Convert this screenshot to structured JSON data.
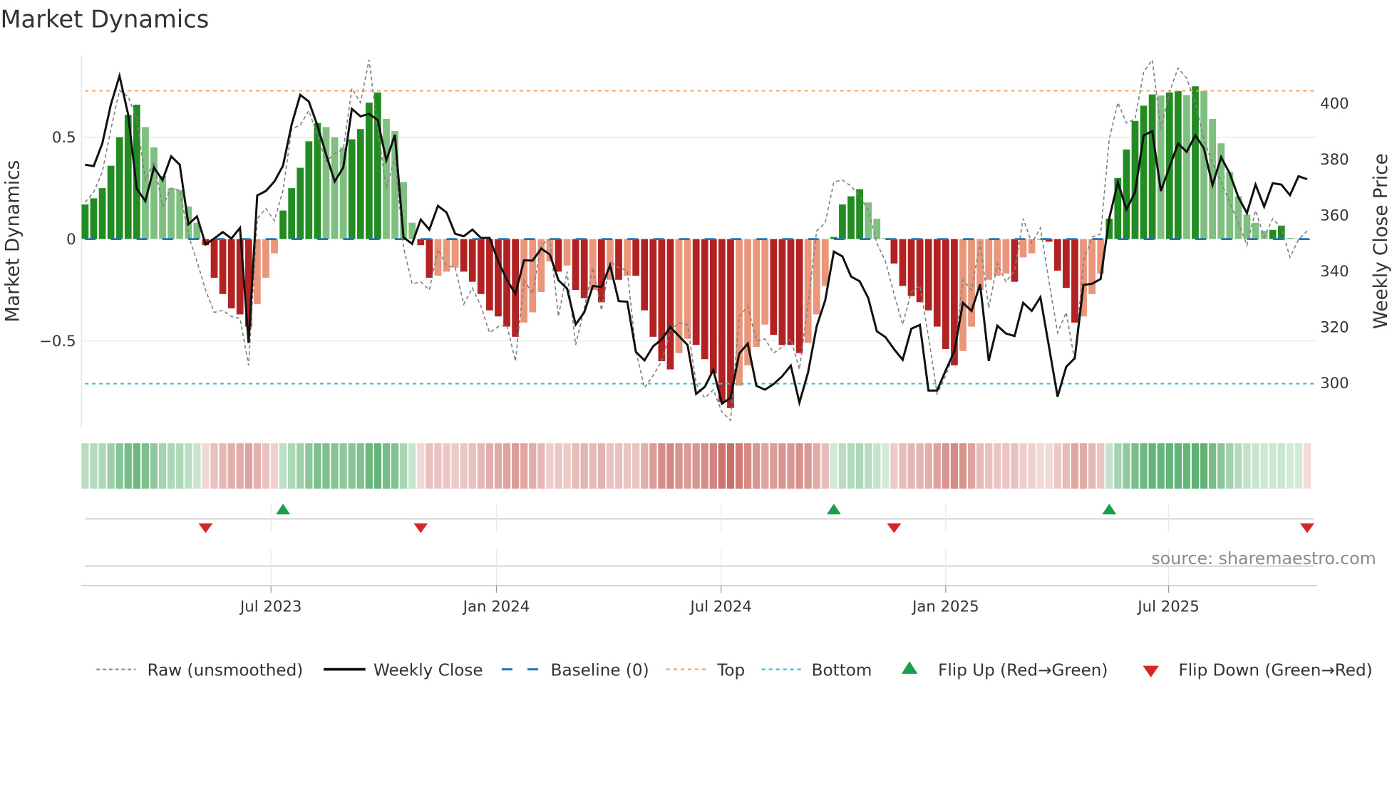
{
  "title": "Market Dynamics",
  "source": "source: sharemaestro.com",
  "colors": {
    "bar_up_strong": "#228b22",
    "bar_up_weak": "#7fbf7f",
    "bar_down_strong": "#b22222",
    "bar_down_weak": "#e9967a",
    "raw": "#808080",
    "close": "#111111",
    "baseline": "#1f77b4",
    "top": "#f4a460",
    "bottom": "#26c6da",
    "flip_up": "#1a9e4a",
    "flip_down": "#d62728"
  },
  "chart_data": {
    "type": "bar",
    "title": "Market Dynamics",
    "ylabel": "Market Dynamics",
    "y2label": "Weekly Close Price",
    "ylim": [
      -0.92,
      0.9
    ],
    "y2lim": [
      284,
      417
    ],
    "yticks": [
      {
        "v": 0.5,
        "label": "0.5"
      },
      {
        "v": 0,
        "label": "0"
      },
      {
        "v": -0.5,
        "label": "−0.5"
      }
    ],
    "y2ticks": [
      {
        "v": 300,
        "label": "300"
      },
      {
        "v": 320,
        "label": "320"
      },
      {
        "v": 340,
        "label": "340"
      },
      {
        "v": 360,
        "label": "360"
      },
      {
        "v": 380,
        "label": "380"
      },
      {
        "v": 400,
        "label": "400"
      }
    ],
    "xticks": [
      {
        "week": 21.6,
        "label": "Jul 2023"
      },
      {
        "week": 47.8,
        "label": "Jan 2024"
      },
      {
        "week": 73.9,
        "label": "Jul 2024"
      },
      {
        "week": 100.0,
        "label": "Jan 2025"
      },
      {
        "week": 125.9,
        "label": "Jul 2025"
      }
    ],
    "thresholds": {
      "baseline": 0,
      "top": 0.728,
      "bottom": -0.71
    },
    "dynamics": [
      0.17,
      0.2,
      0.25,
      0.36,
      0.5,
      0.61,
      0.66,
      0.55,
      0.45,
      0.31,
      0.25,
      0.24,
      0.16,
      0.08,
      -0.03,
      -0.19,
      -0.27,
      -0.34,
      -0.37,
      -0.43,
      -0.32,
      -0.19,
      -0.07,
      0.14,
      0.25,
      0.35,
      0.48,
      0.57,
      0.55,
      0.5,
      0.45,
      0.49,
      0.54,
      0.67,
      0.72,
      0.59,
      0.53,
      0.28,
      0.08,
      -0.03,
      -0.19,
      -0.18,
      -0.16,
      -0.14,
      -0.16,
      -0.21,
      -0.27,
      -0.35,
      -0.38,
      -0.43,
      -0.48,
      -0.41,
      -0.36,
      -0.26,
      -0.11,
      -0.16,
      -0.13,
      -0.25,
      -0.29,
      -0.25,
      -0.31,
      -0.2,
      -0.2,
      -0.18,
      -0.18,
      -0.35,
      -0.48,
      -0.6,
      -0.64,
      -0.56,
      -0.49,
      -0.52,
      -0.59,
      -0.66,
      -0.8,
      -0.83,
      -0.72,
      -0.62,
      -0.53,
      -0.42,
      -0.47,
      -0.52,
      -0.52,
      -0.56,
      -0.51,
      -0.37,
      -0.23,
      0.01,
      0.17,
      0.21,
      0.245,
      0.18,
      0.1,
      0.005,
      -0.12,
      -0.23,
      -0.28,
      -0.31,
      -0.35,
      -0.43,
      -0.54,
      -0.62,
      -0.55,
      -0.43,
      -0.25,
      -0.2,
      -0.18,
      -0.17,
      -0.21,
      -0.09,
      -0.07,
      -0.005,
      -0.013,
      -0.155,
      -0.24,
      -0.41,
      -0.38,
      -0.27,
      -0.17,
      0.1,
      0.3,
      0.44,
      0.58,
      0.655,
      0.71,
      0.705,
      0.72,
      0.727,
      0.707,
      0.75,
      0.727,
      0.59,
      0.47,
      0.33,
      0.21,
      0.12,
      0.08,
      0.04,
      0.045,
      0.066,
      0.006,
      0.002,
      -0.002
    ],
    "raw": [
      0.18,
      0.23,
      0.33,
      0.54,
      0.73,
      0.7,
      0.59,
      0.29,
      0.38,
      0.16,
      0.25,
      0.24,
      0.02,
      -0.11,
      -0.25,
      -0.36,
      -0.35,
      -0.38,
      -0.39,
      -0.62,
      0.1,
      0.15,
      0.09,
      0.24,
      0.54,
      0.56,
      0.63,
      0.51,
      0.38,
      0.42,
      0.44,
      0.74,
      0.67,
      0.88,
      0.54,
      0.25,
      0.4,
      -0.04,
      -0.22,
      -0.21,
      -0.25,
      -0.05,
      -0.13,
      -0.14,
      -0.32,
      -0.24,
      -0.33,
      -0.46,
      -0.43,
      -0.42,
      -0.6,
      -0.2,
      -0.27,
      -0.03,
      0.0,
      -0.38,
      -0.16,
      -0.52,
      -0.34,
      -0.14,
      -0.35,
      -0.11,
      -0.14,
      -0.155,
      -0.55,
      -0.73,
      -0.67,
      -0.6,
      -0.45,
      -0.41,
      -0.42,
      -0.71,
      -0.78,
      -0.74,
      -0.85,
      -0.89,
      -0.38,
      -0.33,
      -0.5,
      -0.49,
      -0.56,
      -0.53,
      -0.49,
      -0.64,
      -0.32,
      0.04,
      0.08,
      0.28,
      0.29,
      0.26,
      0.21,
      0.14,
      -0.02,
      -0.11,
      -0.27,
      -0.42,
      -0.26,
      -0.23,
      -0.48,
      -0.76,
      -0.67,
      -0.56,
      -0.2,
      -0.25,
      -0.015,
      -0.34,
      -0.12,
      -0.21,
      -0.155,
      0.1,
      -0.02,
      0.055,
      -0.21,
      -0.46,
      -0.36,
      -0.6,
      -0.11,
      0.01,
      0.025,
      0.49,
      0.67,
      0.57,
      0.59,
      0.82,
      0.88,
      0.54,
      0.72,
      0.84,
      0.79,
      0.67,
      0.49,
      0.37,
      0.28,
      0.18,
      0.08,
      -0.03,
      0.14,
      0.01,
      0.1,
      0.055,
      -0.09,
      -0.003,
      0.04
    ],
    "weekly_close": [
      378,
      377.5,
      385.6,
      399.6,
      409.8,
      396,
      369.4,
      365,
      377,
      372.5,
      381,
      378,
      356.7,
      359.5,
      349.5,
      351.6,
      353.9,
      351.6,
      355.4,
      314.2,
      367,
      368.6,
      372,
      377.7,
      392.4,
      403,
      400.6,
      392,
      381.7,
      372,
      377,
      398,
      395.3,
      396.2,
      394,
      379.6,
      388.7,
      352,
      349.7,
      358.4,
      354.8,
      363.3,
      360.9,
      353.3,
      352.4,
      354.8,
      351.8,
      351.8,
      343.5,
      336.9,
      331.8,
      343.8,
      343.7,
      348,
      345.9,
      336.7,
      333.7,
      320.8,
      325.2,
      334.6,
      334.3,
      342,
      329.2,
      329,
      311,
      308,
      313,
      315.5,
      319.9,
      316.7,
      313.5,
      296,
      298.5,
      304.6,
      292.5,
      294.6,
      310.4,
      314,
      298.9,
      297.5,
      299.5,
      302.3,
      306.1,
      292.9,
      303.6,
      320.1,
      329.5,
      346.9,
      345.2,
      338,
      336.3,
      330.3,
      318.4,
      316.3,
      312,
      308.2,
      319.3,
      320.7,
      297.2,
      297.2,
      304.4,
      311.2,
      328.6,
      325.7,
      335.2,
      307.8,
      320.4,
      317.6,
      316.7,
      328.6,
      325.7,
      330.6,
      312.9,
      295,
      305.7,
      308.8,
      335,
      335.4,
      337.1,
      358.8,
      371.7,
      362,
      368.1,
      388.5,
      390,
      368.6,
      377.1,
      385.6,
      382.6,
      388.5,
      383.9,
      370.7,
      380.7,
      374.9,
      366.4,
      360.7,
      370.9,
      363,
      371.4,
      370.9,
      367.1,
      373.9,
      372.8
    ],
    "flip_up_weeks": [
      23,
      87,
      119
    ],
    "flip_down_weeks": [
      14,
      39,
      94,
      142
    ],
    "legend": {
      "placement": "bottom",
      "items": [
        {
          "key": "raw",
          "label": "Raw (unsmoothed)"
        },
        {
          "key": "close",
          "label": "Weekly Close"
        },
        {
          "key": "baseline",
          "label": "Baseline (0)"
        },
        {
          "key": "top",
          "label": "Top"
        },
        {
          "key": "bottom",
          "label": "Bottom"
        },
        {
          "key": "flip_up",
          "label": "Flip Up (Red→Green)"
        },
        {
          "key": "flip_down",
          "label": "Flip Down (Green→Red)"
        }
      ]
    }
  }
}
